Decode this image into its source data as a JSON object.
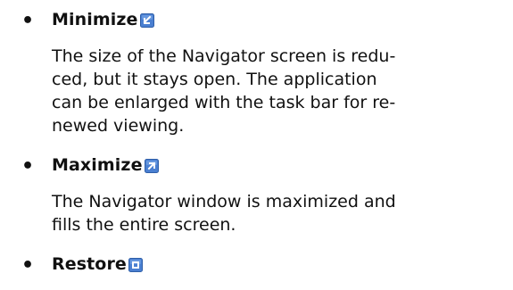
{
  "items": [
    {
      "title": "Minimize",
      "icon": "minimize-icon",
      "lines": [
        "The size of the Navigator screen is redu-",
        "ced, but it stays open.  The application",
        "can be enlarged with the task bar for re-",
        "newed viewing."
      ]
    },
    {
      "title": "Maximize",
      "icon": "maximize-icon",
      "lines": [
        "The Navigator window is maximized and",
        "fills the entire screen."
      ]
    },
    {
      "title": "Restore",
      "icon": "restore-icon",
      "lines": []
    }
  ],
  "colors": {
    "text": "#111111",
    "icon_fill": "#4a7fd1",
    "icon_border": "#2f5fa8",
    "icon_glyph": "#ffffff"
  }
}
